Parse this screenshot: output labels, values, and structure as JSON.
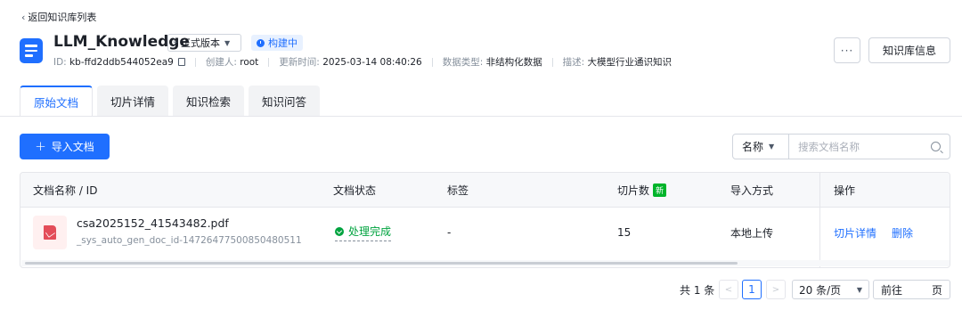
{
  "nav": {
    "back_label": "返回知识库列表"
  },
  "kb": {
    "title": "LLM_Knowledge",
    "version_label": "正式版本",
    "status_label": "构建中",
    "id_label": "ID:",
    "id_value": "kb-ffd2ddb544052ea9",
    "creator_label": "创建人:",
    "creator_value": "root",
    "updated_label": "更新时间:",
    "updated_value": "2025-03-14 08:40:26",
    "datatype_label": "数据类型:",
    "datatype_value": "非结构化数据",
    "desc_label": "描述:",
    "desc_value": "大模型行业通识知识"
  },
  "header_actions": {
    "more_label": "···",
    "info_label": "知识库信息"
  },
  "tabs": [
    {
      "label": "原始文档",
      "active": true
    },
    {
      "label": "切片详情",
      "active": false
    },
    {
      "label": "知识检索",
      "active": false
    },
    {
      "label": "知识问答",
      "active": false
    }
  ],
  "toolbar": {
    "import_icon": "+",
    "import_label": "导入文档",
    "filter_value": "名称",
    "search_placeholder": "搜索文档名称"
  },
  "table": {
    "columns": [
      "文档名称 / ID",
      "文档状态",
      "标签",
      "切片数",
      "导入方式",
      "操作"
    ],
    "new_badge": "新",
    "rows": [
      {
        "name": "csa2025152_41543482.pdf",
        "id": "_sys_auto_gen_doc_id-14726477500850480511",
        "status": "处理完成",
        "tag": "-",
        "slices": "15",
        "import_method": "本地上传",
        "action_detail": "切片详情",
        "action_delete": "删除"
      }
    ]
  },
  "pagination": {
    "total_text": "共 1 条",
    "prev": "<",
    "current_page": "1",
    "next": ">",
    "page_size": "20 条/页",
    "jump_prefix": "前往",
    "jump_suffix": "页"
  },
  "colors": {
    "primary": "#1f6fff",
    "success": "#00a33f",
    "pdf_red": "#e34d59"
  }
}
